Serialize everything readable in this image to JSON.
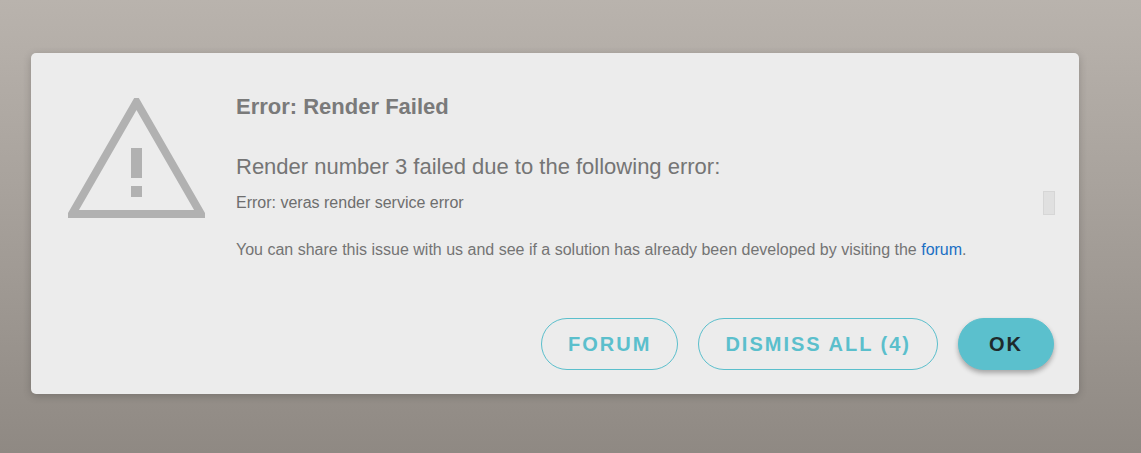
{
  "dialog": {
    "title": "Error: Render Failed",
    "message": "Render number 3 failed due to the following error:",
    "error": "Error: veras render service error",
    "help": {
      "text": "You can share this issue with us and see if a solution has already been developed by visiting the ",
      "link": "forum",
      "suffix": "."
    }
  },
  "buttons": [
    {
      "label": "FORUM",
      "kind": "outlined"
    },
    {
      "label": "DISMISS ALL (4)",
      "kind": "outlined"
    },
    {
      "label": "OK",
      "kind": "filled"
    }
  ]
}
